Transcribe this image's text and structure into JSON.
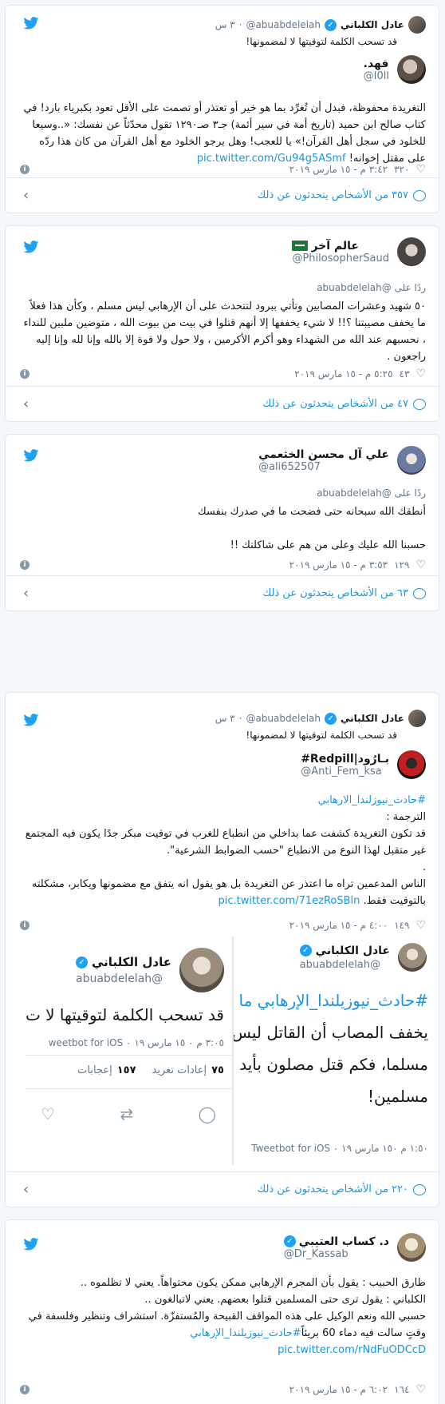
{
  "cards": [
    {
      "context": {
        "name": "عادل الكلباني",
        "handle": "@abuabdelelah",
        "time": "٣ س",
        "text": "قد تسحب الكلمة لتوقيتها لا لمضمونها!"
      },
      "author": {
        "name": "فهد.",
        "handle": "@I0ll"
      },
      "body": "التغريدة محفوظة، فبدل أن تُغرِّد بما هو خير أو تعتذر أو تصمت على الأقل تعود بكبرياء بارد! في كتاب صالح ابن حميد (تاريخ أمة في سير أئمة) جـ٣ صـ١٢٩٠ تقول محدّثاً عن نفسك: «..وسيعا للخلود في سجل أهل القرآن!» يا للعجب! وهل يرجو الخلود مع أهل القرآن من كان هذا ردّه على مقتل إخوانه!",
      "link": "pic.twitter.com/Gu94g5ASmf",
      "likes": "٣٢٠",
      "time": "٣:٤٢ م - ١٥ مارس ٢٠١٩",
      "footer": "٣٥٧ من الأشخاص يتحدثون عن ذلك"
    },
    {
      "author": {
        "name": "عالم آخر",
        "handle": "@PhilosopherSaud"
      },
      "replyto": "ردًا على @abuabdelelah",
      "body": "٥٠ شهيد وعشرات المصابين وتأتي ببرود لتتحدث على أن الإرهابي ليس مسلم ، وكأن هذا فعلاً ما يخفف مصيبتنا ؟!! لا شيء يخففها إلا أنهم قتلوا في بيت من بيوت الله ، متوضين ملبين للنداء ، نحسبهم عند الله من الشهداء وهو أكرم الأكرمين ، ولا حول ولا قوة إلا بالله وإنا لله وإنا إليه راجعون .",
      "likes": "٤٣",
      "time": "٥:٢٥ م - ١٥ مارس ٢٠١٩",
      "footer": "٤٧ من الأشخاص يتحدثون عن ذلك"
    },
    {
      "author": {
        "name": "علي آل محسن الخثعمي",
        "handle": "@ali652507"
      },
      "replyto": "ردًا على @abuabdelelah",
      "body1": "أنطقك الله سبحانه حتى فضحت ما في صدرك بنفسك",
      "body2": "حسبنا الله عليك وعلى من هم على شاكلتك !!",
      "likes": "١٢٩",
      "time": "٣:٥٣ م - ١٥ مارس ٢٠١٩",
      "footer": "٦٣ من الأشخاص يتحدثون عن ذلك"
    },
    {
      "context": {
        "name": "عادل الكلباني",
        "handle": "@abuabdelelah",
        "time": "٣ س",
        "text": "قد تسحب الكلمة لتوقيتها لا لمضمونها!"
      },
      "author": {
        "name": "بـارُود|Redpill#",
        "handle": "@Anti_Fem_ksa"
      },
      "hashtag": "#حادث_نيوزلندا_الارهابي",
      "body1": "الترجمة :",
      "body2": "قد تكون التغريدة كشفت عما بداخلي من انطباع للغرب في توقيت مبكر جدًا يكون فيه المجتمع غير متقبل لهذا النوع من الانطباع \"حسب الضوابط الشرعية\".",
      "body3": ".",
      "body4": "الناس المدعمين تراه ما اعتذر عن التغريدة بل هو يقول انه يتفق مع مضمونها ويكابر، مشكلته بالتوقيت فقط.",
      "link": "pic.twitter.com/71ezRoSBln",
      "likes": "١٤٩",
      "time": "٤:٠٠ م - ١٥ مارس ٢٠١٩",
      "imgL": {
        "name": "عادل الكلباني",
        "handle": "@abuabdelelah",
        "text": "قد تسحب الكلمة لتوقيتها لا ت",
        "via": "٣:٠٥ م ٠ ١٥ مارس ١٩ ٠ weetbot for iOS",
        "retweets": "٧٥",
        "retweets_label": "إعادات تغريد",
        "likes": "١٥٧",
        "likes_label": "إعجابات"
      },
      "imgR": {
        "name": "عادل الكلباني",
        "handle": "@abuabdelelah",
        "line1": "#حادث_نيوزيلندا_الإرهابي ما",
        "line2": "يخفف المصاب أن القاتل ليس",
        "line3": "مسلما، فكم قتل مصلون بأيد",
        "line4": "مسلمين!",
        "via": "١:٥٠ م ١٥٠ مارس ١٩ ٠ Tweetbot for iOS"
      },
      "footer": "٢٢٠ من الأشخاص يتحدثون عن ذلك"
    },
    {
      "author": {
        "name": "د. كساب العتيبي",
        "handle": "@Dr_Kassab"
      },
      "body1": "طارق الحبيب : يقول بأن المجرم الإرهابي ممكن يكون محتواهاً. يعني لا تظلموه ..",
      "body2": "الكلباني : يقول ترى حتى المسلمين قتلوا بعضهم. يعني لاتبالغون ..",
      "body3": "حسبي الله ونعم الوكيل على هذه المواقف القبيحة والمُستفزّة. استشراف وتنظير وفلسفة في وقتٍ سالت فيه دماء 60 بريئاً",
      "hashtag": "#حادث_نيوزيلندا_الإرهابي",
      "link": "pic.twitter.com/rNdFuODCcD",
      "likes": "١٦٤",
      "time": "٦:٠٢ م - ١٥ مارس ٢٠١٩"
    }
  ],
  "colors": {
    "brand": "#1da1f2",
    "link": "#1b95e0",
    "muted": "#657786"
  }
}
